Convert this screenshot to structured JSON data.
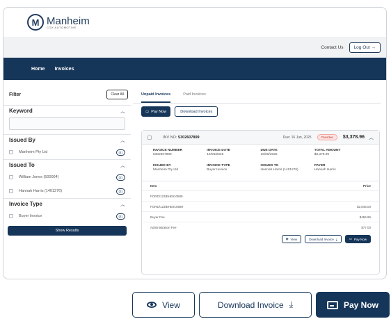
{
  "brand": {
    "name": "Manheim",
    "sub": "COX AUTOMOTIVE"
  },
  "topbar": {
    "contact": "Contact Us",
    "logout": "Log Out →"
  },
  "nav": {
    "home": "Home",
    "invoices": "Invoices"
  },
  "filter": {
    "title": "Filter",
    "clear": "Clear All",
    "keyword": "Keyword",
    "issued_by": {
      "title": "Issued By",
      "options": [
        {
          "label": "Manheim Pty Ltd",
          "count": "(4)"
        }
      ]
    },
    "issued_to": {
      "title": "Issued To",
      "options": [
        {
          "label": "William Jones (500004)",
          "count": "(2)"
        },
        {
          "label": "Hannah Harris (1401276)",
          "count": "(2)"
        }
      ]
    },
    "invoice_type": {
      "title": "Invoice Type",
      "options": [
        {
          "label": "Buyer Invoice",
          "count": "(4)"
        }
      ]
    },
    "show_results": "Show Results"
  },
  "tabs": {
    "unpaid": "Unpaid Invoices",
    "paid": "Paid Invoices"
  },
  "actions": {
    "pay_now": "Pay Now",
    "download": "Download Invoices"
  },
  "invoice": {
    "inv_label": "INV NO:",
    "inv_no": "5302607899",
    "due": "Due: 16 Jun, 2025",
    "status": "Overdue",
    "total": "$3,378.96",
    "fields": [
      {
        "label": "INVOICE NUMBER",
        "value": "5302607899"
      },
      {
        "label": "INVOICE DATE",
        "value": "16/06/2025"
      },
      {
        "label": "DUE DATE",
        "value": "16/06/2025"
      },
      {
        "label": "TOTAL AMOUNT",
        "value": "$3,378.96"
      },
      {
        "label": "ISSUED BY",
        "value": "Manheim Pty Ltd"
      },
      {
        "label": "INVOICE TYPE",
        "value": "Buyer Invoice"
      },
      {
        "label": "ISSUED TO",
        "value": "Hannah Harris (1401276)"
      },
      {
        "label": "PAYER",
        "value": "Hannah Harris"
      }
    ],
    "items_header": {
      "item": "Item",
      "price": "Price"
    },
    "items": [
      {
        "item": "FORD/123/EH£910589",
        "price": ""
      },
      {
        "item": "FORD/123/EHE910589",
        "price": "$2,845.00"
      },
      {
        "item": "Buyer Fee",
        "price": "$456.96"
      },
      {
        "item": "Administration Fee",
        "price": "$77.00"
      }
    ],
    "btn_view": "View",
    "btn_download": "Download Invoice",
    "btn_pay": "Pay Now"
  },
  "zoom": {
    "view": "View",
    "download": "Download Invoice",
    "pay": "Pay Now"
  },
  "colors": {
    "navy": "#163659",
    "overdue": "#c0392b"
  }
}
